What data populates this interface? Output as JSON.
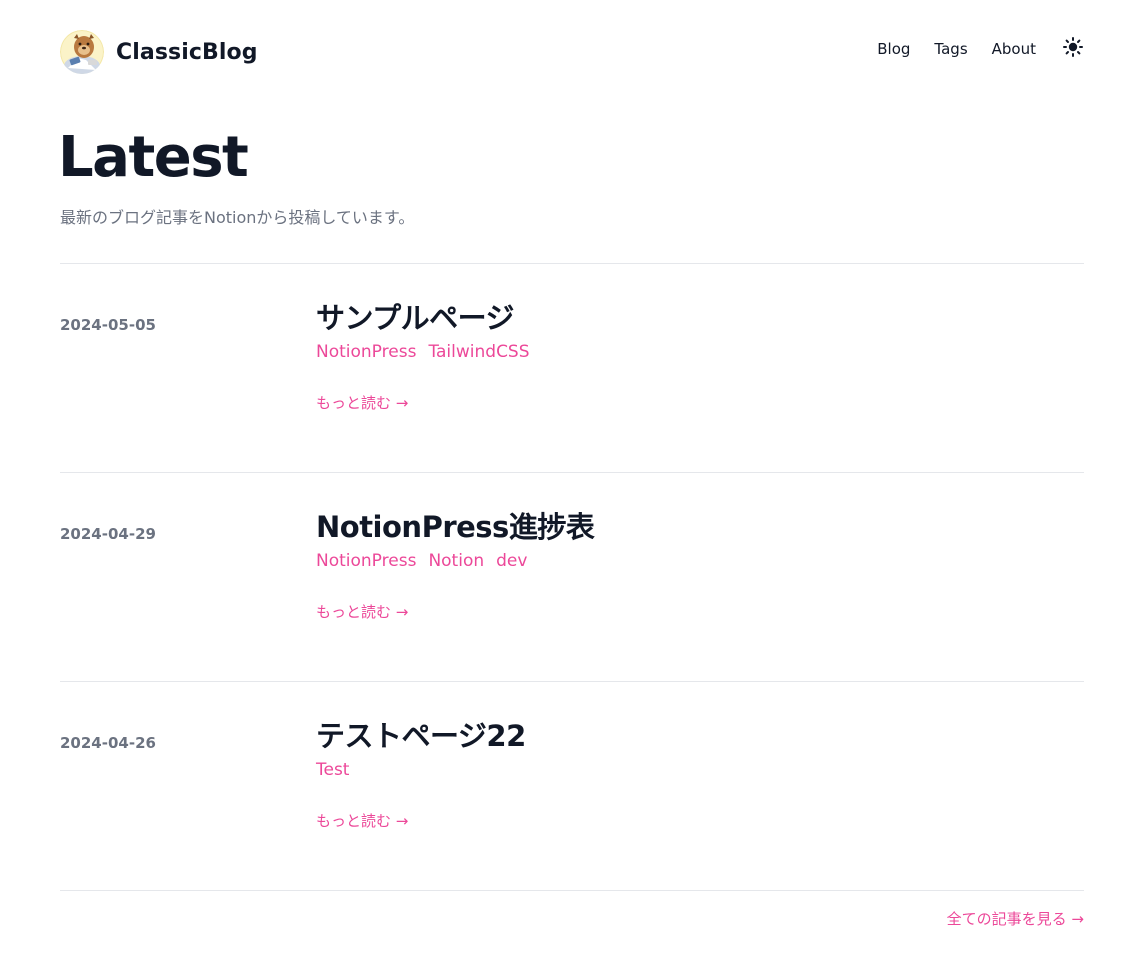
{
  "header": {
    "brand_name": "ClassicBlog",
    "avatar_icon": "cartoon-avatar-icon",
    "nav": [
      {
        "label": "Blog"
      },
      {
        "label": "Tags"
      },
      {
        "label": "About"
      }
    ],
    "theme_icon": "sun-icon"
  },
  "hero": {
    "title": "Latest",
    "description": "最新のブログ記事をNotionから投稿しています。"
  },
  "posts": [
    {
      "date": "2024-05-05",
      "title": "サンプルページ",
      "tags": [
        "NotionPress",
        "TailwindCSS"
      ],
      "read_more": "もっと読む →"
    },
    {
      "date": "2024-04-29",
      "title": "NotionPress進捗表",
      "tags": [
        "NotionPress",
        "Notion",
        "dev"
      ],
      "read_more": "もっと読む →"
    },
    {
      "date": "2024-04-26",
      "title": "テストページ22",
      "tags": [
        "Test"
      ],
      "read_more": "もっと読む →"
    }
  ],
  "footer_link": "全ての記事を見る →",
  "colors": {
    "accent": "#ec4899",
    "text": "#111827",
    "muted": "#6b7280",
    "divider": "#e5e7eb"
  }
}
